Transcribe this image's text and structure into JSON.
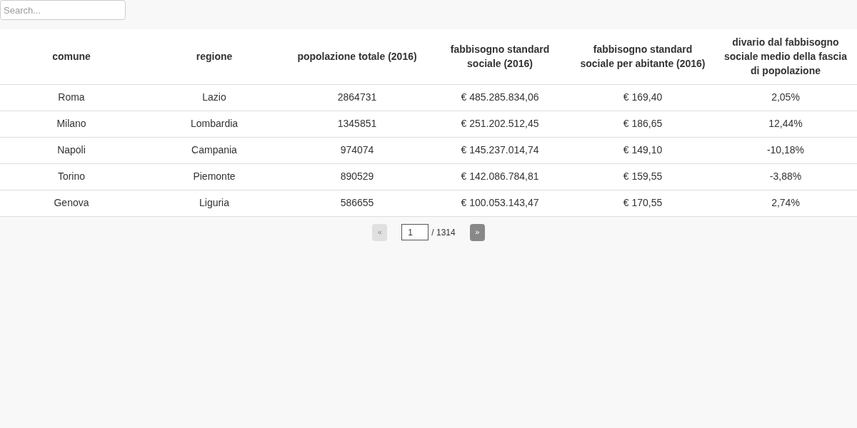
{
  "search": {
    "placeholder": "Search..."
  },
  "table": {
    "columns": [
      "comune",
      "regione",
      "popolazione totale (2016)",
      "fabbisogno standard sociale (2016)",
      "fabbisogno standard sociale per abitante (2016)",
      "divario dal fabbisogno sociale medio della fascia di popolazione"
    ],
    "rows": [
      [
        "Roma",
        "Lazio",
        "2864731",
        "€ 485.285.834,06",
        "€ 169,40",
        "2,05%"
      ],
      [
        "Milano",
        "Lombardia",
        "1345851",
        "€ 251.202.512,45",
        "€ 186,65",
        "12,44%"
      ],
      [
        "Napoli",
        "Campania",
        "974074",
        "€ 145.237.014,74",
        "€ 149,10",
        "-10,18%"
      ],
      [
        "Torino",
        "Piemonte",
        "890529",
        "€ 142.086.784,81",
        "€ 159,55",
        "-3,88%"
      ],
      [
        "Genova",
        "Liguria",
        "586655",
        "€ 100.053.143,47",
        "€ 170,55",
        "2,74%"
      ]
    ]
  },
  "pagination": {
    "previous": {
      "label": "«",
      "disabled": true
    },
    "page": "1",
    "total": "/ 1314",
    "next": {
      "label": "»",
      "disabled": false
    }
  }
}
